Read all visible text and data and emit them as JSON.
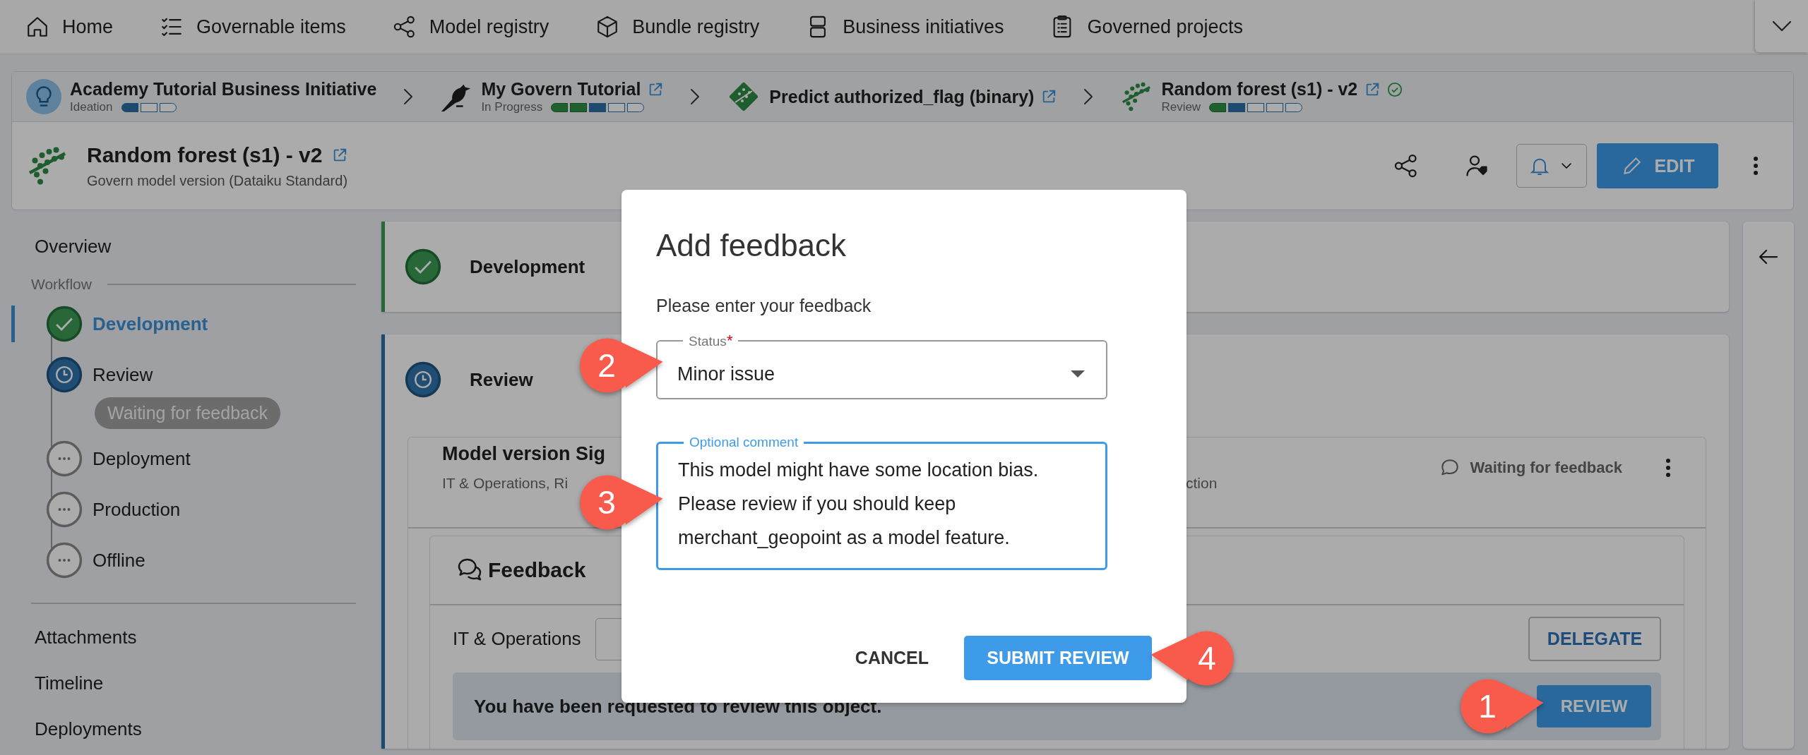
{
  "nav": {
    "items": [
      {
        "kind": "home",
        "label": "Home"
      },
      {
        "kind": "checklist",
        "label": "Governable items"
      },
      {
        "kind": "nodes",
        "label": "Model registry"
      },
      {
        "kind": "cube",
        "label": "Bundle registry"
      },
      {
        "kind": "stack",
        "label": "Business initiatives"
      },
      {
        "kind": "clipboard",
        "label": "Governed projects"
      }
    ]
  },
  "breadcrumbs": [
    {
      "kind": "bulb",
      "title": "Academy Tutorial Business Initiative",
      "stage": "Ideation",
      "progress": [
        {
          "kind": "current"
        },
        {
          "kind": "todo"
        },
        {
          "kind": "todo"
        }
      ],
      "external_link": false,
      "verified": false
    },
    {
      "kind": "bird",
      "title": "My Govern Tutorial",
      "stage": "In Progress",
      "progress": [
        {
          "kind": "done"
        },
        {
          "kind": "done"
        },
        {
          "kind": "current"
        },
        {
          "kind": "todo"
        },
        {
          "kind": "todo"
        }
      ],
      "external_link": true,
      "verified": false
    },
    {
      "kind": "diamond",
      "title": "Predict authorized_flag (binary)",
      "external_link": true,
      "verified": false
    },
    {
      "kind": "forest",
      "title": "Random forest (s1) - v2",
      "stage": "Review",
      "progress": [
        {
          "kind": "done"
        },
        {
          "kind": "current"
        },
        {
          "kind": "todo"
        },
        {
          "kind": "todo"
        },
        {
          "kind": "todo"
        }
      ],
      "external_link": true,
      "verified": true
    }
  ],
  "header": {
    "title": "Random forest (s1) - v2",
    "external_link": true,
    "subtitle": "Govern model version (Dataiku Standard)",
    "edit_button": "EDIT"
  },
  "sidebar": {
    "top": [
      {
        "label": "Overview",
        "selected": false
      }
    ],
    "section_label": "Workflow",
    "steps": [
      {
        "label": "Development",
        "kind": "done",
        "selected": true
      },
      {
        "label": "Review",
        "kind": "active",
        "selected": false,
        "badge": "Waiting for feedback"
      },
      {
        "label": "Deployment",
        "kind": "pending",
        "selected": false
      },
      {
        "label": "Production",
        "kind": "pending",
        "selected": false
      },
      {
        "label": "Offline",
        "kind": "pending",
        "selected": false
      }
    ],
    "bottom": [
      {
        "label": "Attachments",
        "selected": false
      },
      {
        "label": "Timeline",
        "selected": false
      },
      {
        "label": "Deployments",
        "selected": false
      }
    ]
  },
  "main": {
    "steps": [
      {
        "title": "Development",
        "kind": "done"
      },
      {
        "title": "Review",
        "kind": "active"
      }
    ],
    "signoff": {
      "title": "Model version Sig",
      "subtitle": "IT & Operations, Ri",
      "subtitle_tail": "ction",
      "status": "Waiting for feedback"
    },
    "feedback": {
      "title": "Feedback",
      "group": "IT & Operations",
      "delegate_button": "DELEGATE",
      "request": {
        "message": "You have been requested to review this object.",
        "button": "REVIEW",
        "callout": {
          "label": "1",
          "kind": "right"
        }
      }
    }
  },
  "dialog": {
    "title": "Add feedback",
    "prompt": "Please enter your feedback",
    "status_field": {
      "label": "Status",
      "required_mark": "*",
      "value": "Minor issue",
      "callout": {
        "label": "2",
        "kind": "right"
      }
    },
    "comment_field": {
      "label": "Optional comment",
      "focused": true,
      "value": "This model might have some location bias. Please review if you should keep merchant_geopoint as a model feature.",
      "callout": {
        "label": "3",
        "kind": "right"
      }
    },
    "cancel_button": "CANCEL",
    "submit_button": {
      "label": "SUBMIT REVIEW",
      "callout": {
        "label": "4",
        "kind": "left"
      }
    }
  }
}
